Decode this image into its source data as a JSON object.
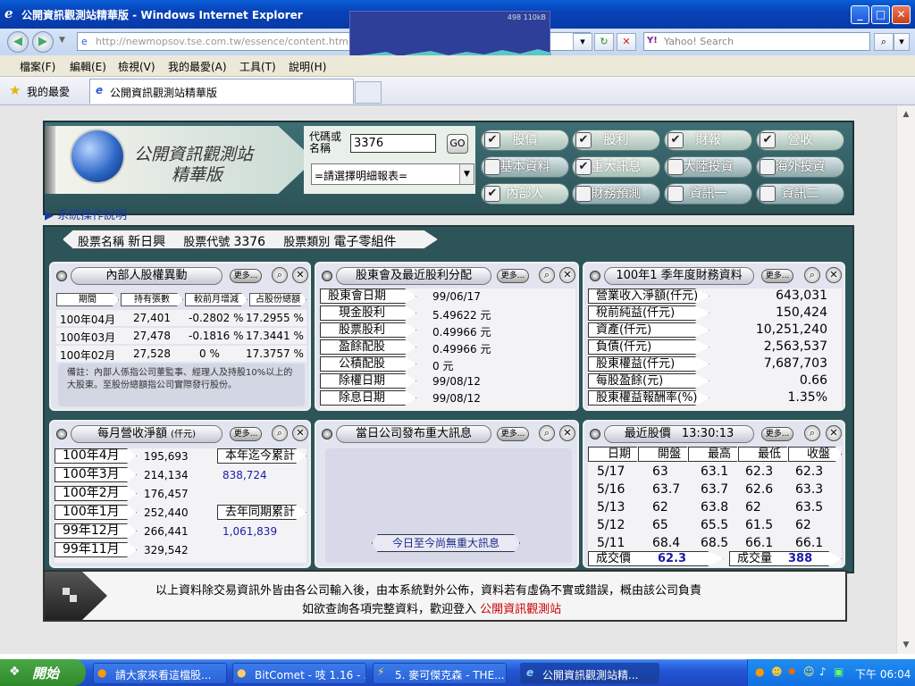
{
  "window": {
    "title": "公開資訊觀測站精華版 - Windows Internet Explorer",
    "net_meter": "498 110kB"
  },
  "address": {
    "url": "http://newmopsov.tse.com.tw/essence/content.html",
    "search_placeholder": "Yahoo! Search"
  },
  "menu": [
    "檔案(F)",
    "編輯(E)",
    "檢視(V)",
    "我的最愛(A)",
    "工具(T)",
    "說明(H)"
  ],
  "favorites": {
    "label": "我的最愛",
    "tab": "公開資訊觀測站精華版"
  },
  "site": {
    "title_line1": "公開資訊觀測站",
    "title_line2": "精華版",
    "code_label": "代碼或名稱",
    "code_value": "3376",
    "go": "GO",
    "report_select": "=請選擇明細報表=",
    "help": "系統操作說明"
  },
  "checks": [
    {
      "label": "股價",
      "checked": true
    },
    {
      "label": "股利",
      "checked": true
    },
    {
      "label": "財報",
      "checked": true
    },
    {
      "label": "營收",
      "checked": true
    },
    {
      "label": "基本資料",
      "checked": false
    },
    {
      "label": "重大訊息",
      "checked": true
    },
    {
      "label": "大陸投資",
      "checked": false
    },
    {
      "label": "海外投資",
      "checked": false
    },
    {
      "label": "內部人",
      "checked": true
    },
    {
      "label": "財務預測",
      "checked": false
    },
    {
      "label": "資訊一",
      "checked": false
    },
    {
      "label": "資訊二",
      "checked": false
    }
  ],
  "stock": {
    "name_label": "股票名稱",
    "name": "新日興",
    "code_label": "股票代號",
    "code": "3376",
    "type_label": "股票類別",
    "type": "電子零組件"
  },
  "more": "更多...",
  "insider": {
    "title": "內部人股權異動",
    "headers": [
      "期間",
      "持有張數",
      "較前月增減",
      "占股份總額"
    ],
    "rows": [
      [
        "100年04月",
        "27,401",
        "-0.2802 %",
        "17.2955 %"
      ],
      [
        "100年03月",
        "27,478",
        "-0.1816 %",
        "17.3441 %"
      ],
      [
        "100年02月",
        "27,528",
        "0 %",
        "17.3757 %"
      ]
    ],
    "note": "備註：內部人係指公司董監事、經理人及持股10%以上的大股東。至股份總額指公司實際發行股份。"
  },
  "dividend": {
    "title": "股東會及最近股利分配",
    "rows": [
      [
        "股東會日期",
        "99/06/17"
      ],
      [
        "現金股利",
        "5.49622 元"
      ],
      [
        "股票股利",
        "0.49966 元"
      ],
      [
        "盈餘配股",
        "0.49966 元"
      ],
      [
        "公積配股",
        "0 元"
      ],
      [
        "除權日期",
        "99/08/12"
      ],
      [
        "除息日期",
        "99/08/12"
      ]
    ]
  },
  "finance": {
    "title": "100年1 季年度財務資料",
    "rows": [
      [
        "營業收入淨額(仟元)",
        "643,031"
      ],
      [
        "稅前純益(仟元)",
        "150,424"
      ],
      [
        "資產(仟元)",
        "10,251,240"
      ],
      [
        "負債(仟元)",
        "2,563,537"
      ],
      [
        "股東權益(仟元)",
        "7,687,703"
      ],
      [
        "每股盈餘(元)",
        "0.66"
      ],
      [
        "股東權益報酬率(%)",
        "1.35%"
      ]
    ]
  },
  "revenue": {
    "title": "每月營收淨額",
    "unit": "(仟元)",
    "rows": [
      [
        "100年4月",
        "195,693"
      ],
      [
        "100年3月",
        "214,134"
      ],
      [
        "100年2月",
        "176,457"
      ],
      [
        "100年1月",
        "252,440"
      ],
      [
        "99年12月",
        "266,441"
      ],
      [
        "99年11月",
        "329,542"
      ]
    ],
    "ytd_label": "本年迄今累計",
    "ytd": "838,724",
    "prev_label": "去年同期累計",
    "prev": "1,061,839"
  },
  "news": {
    "title": "當日公司發布重大訊息",
    "empty": "今日至今尚無重大訊息"
  },
  "price": {
    "title": "最近股價",
    "time": "13:30:13",
    "headers": [
      "日期",
      "開盤",
      "最高",
      "最低",
      "收盤"
    ],
    "rows": [
      [
        "5/17",
        "63",
        "63.1",
        "62.3",
        "62.3"
      ],
      [
        "5/16",
        "63.7",
        "63.7",
        "62.6",
        "63.3"
      ],
      [
        "5/13",
        "62",
        "63.8",
        "62",
        "63.5"
      ],
      [
        "5/12",
        "65",
        "65.5",
        "61.5",
        "62"
      ],
      [
        "5/11",
        "68.4",
        "68.5",
        "66.1",
        "66.1"
      ]
    ],
    "deal_label": "成交價",
    "deal": "62.3",
    "vol_label": "成交量",
    "vol": "388"
  },
  "footer": {
    "line1": "以上資料除交易資訊外皆由各公司輸入後，由本系統對外公佈，資料若有虛偽不實或錯誤，概由該公司負責",
    "line2": "如欲查詢各項完整資料，歡迎登入",
    "link": "公開資訊觀測站"
  },
  "taskbar": {
    "start": "開始",
    "items": [
      "請大家來看這檔股...",
      "BitComet - 吱 1.16 - ...",
      "5. 麥可傑克森 - THE...",
      "公開資訊觀測站精..."
    ],
    "clock": "下午 06:04"
  },
  "colors": {
    "title_bar": "#0a5fd8",
    "panel_band": "#2d5559",
    "link_red": "#cc0000",
    "blue_value": "#1a1aa8"
  }
}
